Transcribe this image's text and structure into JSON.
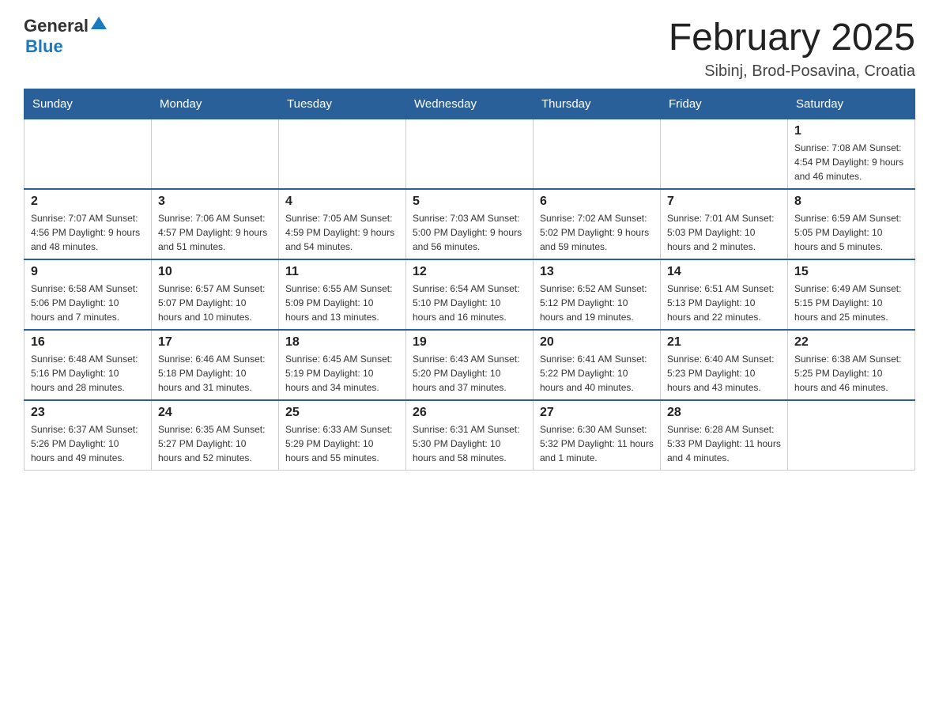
{
  "header": {
    "logo_general": "General",
    "logo_blue": "Blue",
    "month_year": "February 2025",
    "location": "Sibinj, Brod-Posavina, Croatia"
  },
  "days_of_week": [
    "Sunday",
    "Monday",
    "Tuesday",
    "Wednesday",
    "Thursday",
    "Friday",
    "Saturday"
  ],
  "weeks": [
    [
      {
        "day": "",
        "info": ""
      },
      {
        "day": "",
        "info": ""
      },
      {
        "day": "",
        "info": ""
      },
      {
        "day": "",
        "info": ""
      },
      {
        "day": "",
        "info": ""
      },
      {
        "day": "",
        "info": ""
      },
      {
        "day": "1",
        "info": "Sunrise: 7:08 AM\nSunset: 4:54 PM\nDaylight: 9 hours and 46 minutes."
      }
    ],
    [
      {
        "day": "2",
        "info": "Sunrise: 7:07 AM\nSunset: 4:56 PM\nDaylight: 9 hours and 48 minutes."
      },
      {
        "day": "3",
        "info": "Sunrise: 7:06 AM\nSunset: 4:57 PM\nDaylight: 9 hours and 51 minutes."
      },
      {
        "day": "4",
        "info": "Sunrise: 7:05 AM\nSunset: 4:59 PM\nDaylight: 9 hours and 54 minutes."
      },
      {
        "day": "5",
        "info": "Sunrise: 7:03 AM\nSunset: 5:00 PM\nDaylight: 9 hours and 56 minutes."
      },
      {
        "day": "6",
        "info": "Sunrise: 7:02 AM\nSunset: 5:02 PM\nDaylight: 9 hours and 59 minutes."
      },
      {
        "day": "7",
        "info": "Sunrise: 7:01 AM\nSunset: 5:03 PM\nDaylight: 10 hours and 2 minutes."
      },
      {
        "day": "8",
        "info": "Sunrise: 6:59 AM\nSunset: 5:05 PM\nDaylight: 10 hours and 5 minutes."
      }
    ],
    [
      {
        "day": "9",
        "info": "Sunrise: 6:58 AM\nSunset: 5:06 PM\nDaylight: 10 hours and 7 minutes."
      },
      {
        "day": "10",
        "info": "Sunrise: 6:57 AM\nSunset: 5:07 PM\nDaylight: 10 hours and 10 minutes."
      },
      {
        "day": "11",
        "info": "Sunrise: 6:55 AM\nSunset: 5:09 PM\nDaylight: 10 hours and 13 minutes."
      },
      {
        "day": "12",
        "info": "Sunrise: 6:54 AM\nSunset: 5:10 PM\nDaylight: 10 hours and 16 minutes."
      },
      {
        "day": "13",
        "info": "Sunrise: 6:52 AM\nSunset: 5:12 PM\nDaylight: 10 hours and 19 minutes."
      },
      {
        "day": "14",
        "info": "Sunrise: 6:51 AM\nSunset: 5:13 PM\nDaylight: 10 hours and 22 minutes."
      },
      {
        "day": "15",
        "info": "Sunrise: 6:49 AM\nSunset: 5:15 PM\nDaylight: 10 hours and 25 minutes."
      }
    ],
    [
      {
        "day": "16",
        "info": "Sunrise: 6:48 AM\nSunset: 5:16 PM\nDaylight: 10 hours and 28 minutes."
      },
      {
        "day": "17",
        "info": "Sunrise: 6:46 AM\nSunset: 5:18 PM\nDaylight: 10 hours and 31 minutes."
      },
      {
        "day": "18",
        "info": "Sunrise: 6:45 AM\nSunset: 5:19 PM\nDaylight: 10 hours and 34 minutes."
      },
      {
        "day": "19",
        "info": "Sunrise: 6:43 AM\nSunset: 5:20 PM\nDaylight: 10 hours and 37 minutes."
      },
      {
        "day": "20",
        "info": "Sunrise: 6:41 AM\nSunset: 5:22 PM\nDaylight: 10 hours and 40 minutes."
      },
      {
        "day": "21",
        "info": "Sunrise: 6:40 AM\nSunset: 5:23 PM\nDaylight: 10 hours and 43 minutes."
      },
      {
        "day": "22",
        "info": "Sunrise: 6:38 AM\nSunset: 5:25 PM\nDaylight: 10 hours and 46 minutes."
      }
    ],
    [
      {
        "day": "23",
        "info": "Sunrise: 6:37 AM\nSunset: 5:26 PM\nDaylight: 10 hours and 49 minutes."
      },
      {
        "day": "24",
        "info": "Sunrise: 6:35 AM\nSunset: 5:27 PM\nDaylight: 10 hours and 52 minutes."
      },
      {
        "day": "25",
        "info": "Sunrise: 6:33 AM\nSunset: 5:29 PM\nDaylight: 10 hours and 55 minutes."
      },
      {
        "day": "26",
        "info": "Sunrise: 6:31 AM\nSunset: 5:30 PM\nDaylight: 10 hours and 58 minutes."
      },
      {
        "day": "27",
        "info": "Sunrise: 6:30 AM\nSunset: 5:32 PM\nDaylight: 11 hours and 1 minute."
      },
      {
        "day": "28",
        "info": "Sunrise: 6:28 AM\nSunset: 5:33 PM\nDaylight: 11 hours and 4 minutes."
      },
      {
        "day": "",
        "info": ""
      }
    ]
  ]
}
